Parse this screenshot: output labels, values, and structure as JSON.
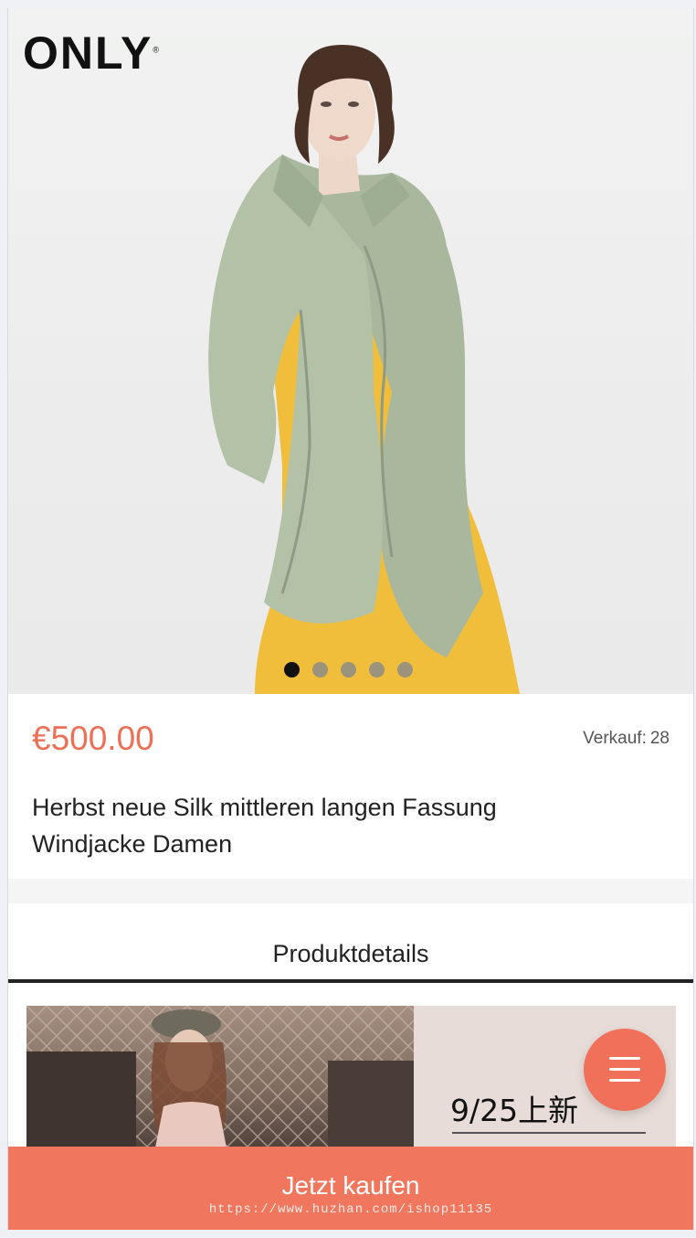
{
  "brand": {
    "logo_text": "ONLY",
    "logo_mark": "®"
  },
  "hero": {
    "slide_count": 5,
    "active_slide": 1
  },
  "product": {
    "price": "€500.00",
    "sales_label": "Verkauf:",
    "sales_count": "28",
    "title": "Herbst neue Silk mittleren langen Fassung Windjacke Damen"
  },
  "details": {
    "tab_label": "Produktdetails",
    "banner_date": "9/25上新"
  },
  "actions": {
    "buy_label": "Jetzt kaufen",
    "menu_icon": "hamburger-menu-icon"
  },
  "watermark": "https://www.huzhan.com/ishop11135",
  "colors": {
    "accent": "#ee6f55",
    "buy_bar": "#f0765e",
    "fab": "#f0705a"
  }
}
